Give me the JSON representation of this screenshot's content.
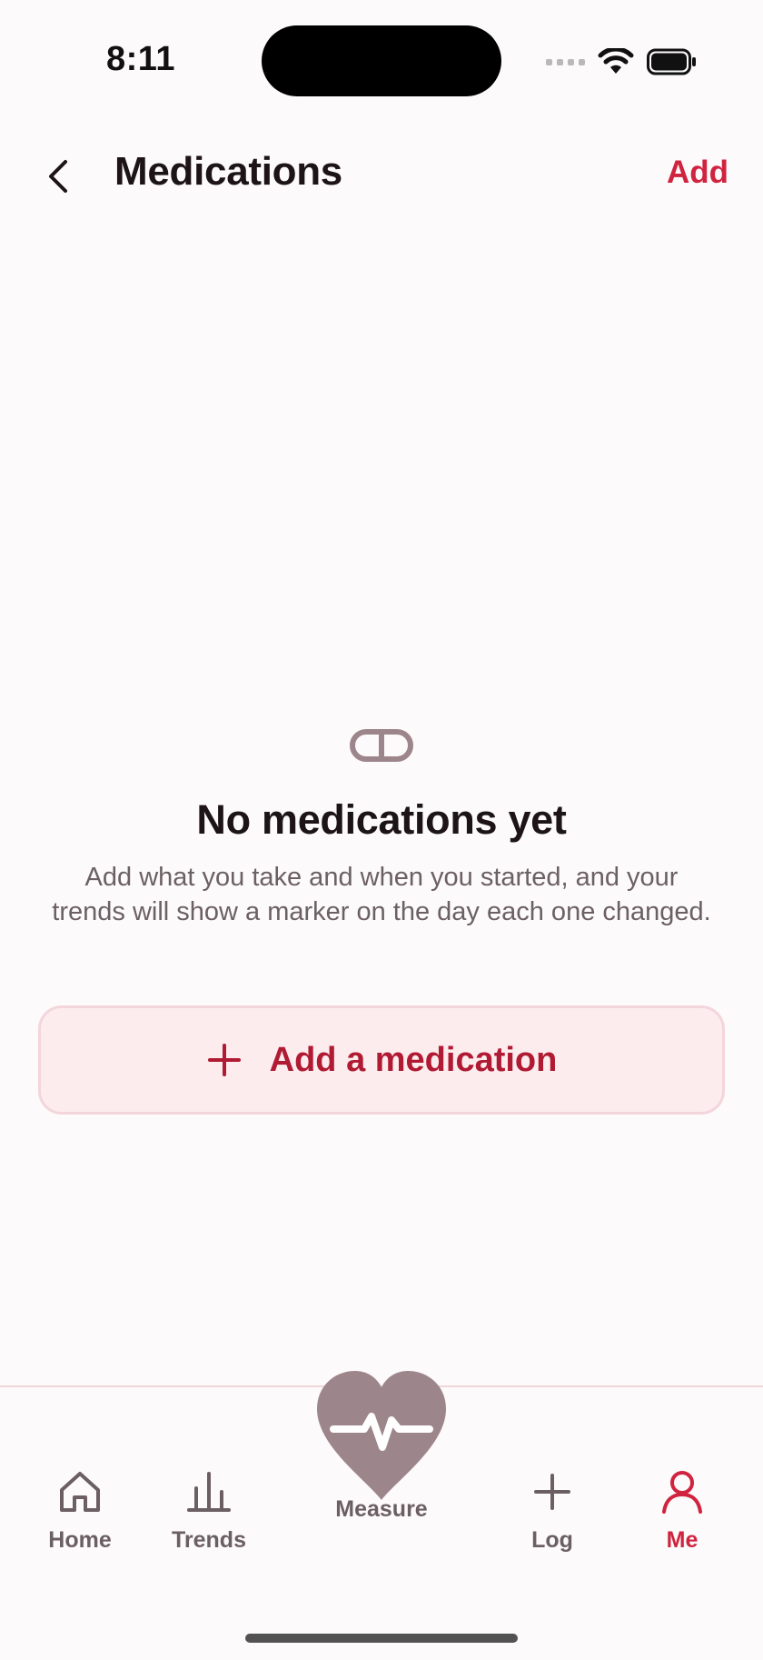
{
  "status_bar": {
    "time": "8:11",
    "icons": [
      "signal-dots-icon",
      "wifi-icon",
      "battery-icon"
    ]
  },
  "nav": {
    "back_icon": "chevron-left-icon",
    "title": "Medications",
    "action_label": "Add"
  },
  "empty_state": {
    "icon": "pill-icon",
    "title": "No medications yet",
    "description": "Add what you take and when you started, and your trends will show a marker on the day each one changed.",
    "button": {
      "icon": "plus-icon",
      "label": "Add a medication"
    }
  },
  "tab_bar": {
    "active": "Me",
    "tabs": [
      {
        "id": "home",
        "label": "Home",
        "icon": "house-icon"
      },
      {
        "id": "trends",
        "label": "Trends",
        "icon": "bar-chart-icon"
      },
      {
        "id": "measure",
        "label": "Measure",
        "icon": "heart-pulse-icon"
      },
      {
        "id": "log",
        "label": "Log",
        "icon": "plus-icon"
      },
      {
        "id": "me",
        "label": "Me",
        "icon": "person-icon"
      }
    ]
  },
  "colors": {
    "accent": "#d0233f",
    "accent_dark": "#b01a33",
    "button_bg": "#fcecee",
    "muted": "#6b5f63",
    "heart": "#9d868b",
    "background": "#fdfafb"
  }
}
